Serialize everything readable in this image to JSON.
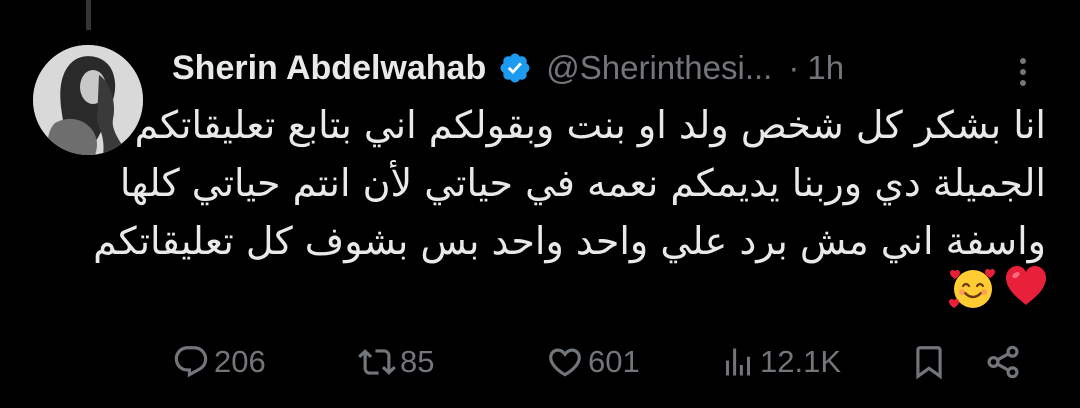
{
  "author": {
    "display_name": "Sherin Abdelwahab",
    "handle": "@Sherinthesi...",
    "verified": true,
    "avatar_icon": "profile-photo"
  },
  "meta": {
    "separator": "·",
    "time": "1h"
  },
  "tweet": {
    "lines": [
      "انا بشكر كل شخص ولد او بنت وبقولكم اني بتابع تعليقاتكم",
      "الجميلة دي وربنا يديمكم نعمه في حياتي لأن انتم حياتي كلها",
      "واسفة اني مش برد علي واحد واحد بس بشوف كل تعليقاتكم"
    ],
    "emojis": [
      "red-heart-icon",
      "smiling-face-with-hearts-icon"
    ]
  },
  "actions": {
    "replies": "206",
    "reposts": "85",
    "likes": "601",
    "views": "12.1K"
  },
  "colors": {
    "background": "#000000",
    "text_primary": "#e7e9ea",
    "text_secondary": "#71767b",
    "verified_blue": "#1d9bf0",
    "heart_red": "#e8203a"
  }
}
